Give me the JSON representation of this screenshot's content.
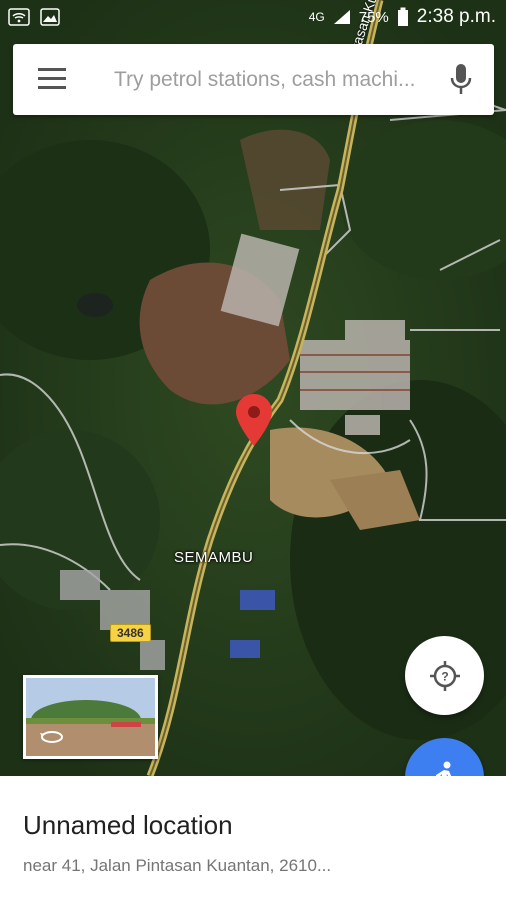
{
  "status_bar": {
    "network": "4G",
    "battery": "75%",
    "time": "2:38 p.m."
  },
  "search": {
    "placeholder": "Try petrol stations, cash machi..."
  },
  "map": {
    "place_label": "SEMAMBU",
    "road_label": "Jalan Pintasan Kuantan",
    "route_shield": "3486"
  },
  "place": {
    "title": "Unnamed location",
    "address": "near 41, Jalan Pintasan Kuantan, 2610..."
  },
  "colors": {
    "fab_walk": "#3d7ff0",
    "pin": "#e53935",
    "highway": "#c8b45a"
  }
}
